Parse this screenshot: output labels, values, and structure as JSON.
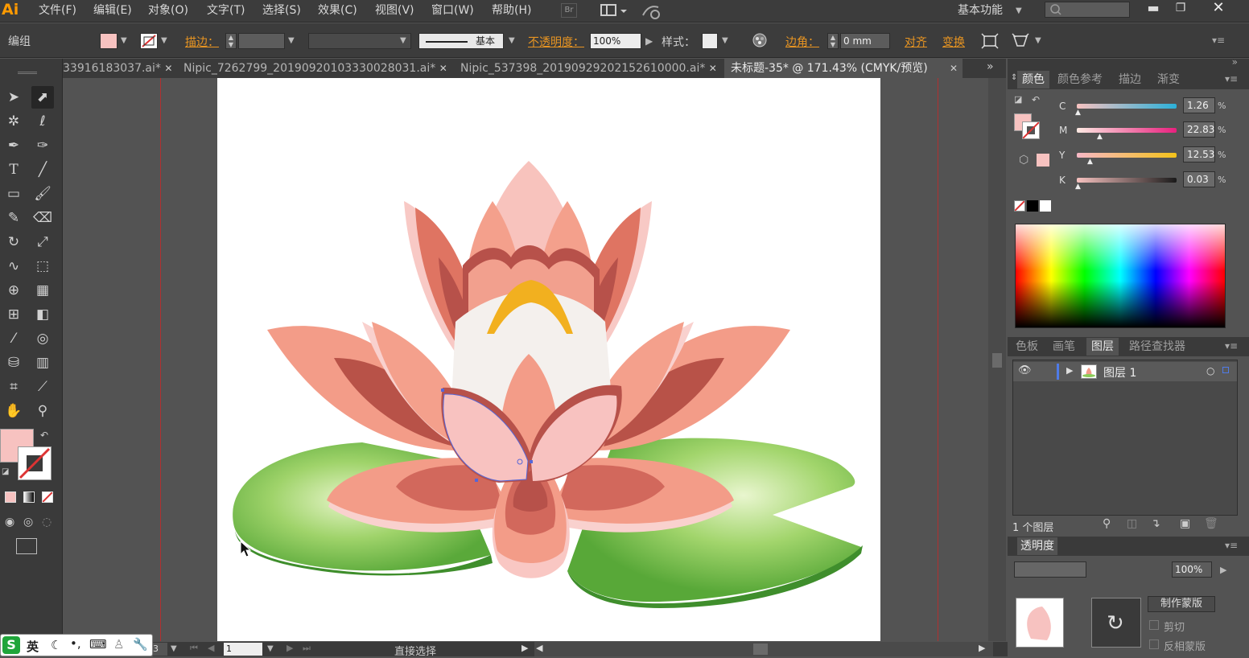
{
  "app": {
    "logo": "Ai"
  },
  "menu": {
    "items": [
      "文件(F)",
      "编辑(E)",
      "对象(O)",
      "文字(T)",
      "选择(S)",
      "效果(C)",
      "视图(V)",
      "窗口(W)",
      "帮助(H)"
    ],
    "br_badge": "Br",
    "workspace": "基本功能"
  },
  "control": {
    "selection_label": "编组",
    "stroke_label": "描边：",
    "stroke_profile": "基本",
    "opacity_label": "不透明度：",
    "opacity_value": "100%",
    "style_label": "样式：",
    "corner_label": "边角：",
    "corner_value": "0 mm",
    "align_label": "对齐",
    "transform_label": "变换"
  },
  "tabs": [
    {
      "label": "33916183037.ai*",
      "active": false
    },
    {
      "label": "Nipic_7262799_20190920103330028031.ai*",
      "active": false
    },
    {
      "label": "Nipic_537398_20190929202152610000.ai*",
      "active": false
    },
    {
      "label": "未标题-35* @ 171.43% (CMYK/预览)",
      "active": true
    }
  ],
  "color_panel": {
    "tabs": [
      "颜色",
      "颜色参考",
      "描边",
      "渐变"
    ],
    "channels": [
      {
        "label": "C",
        "value": "1.26"
      },
      {
        "label": "M",
        "value": "22.83"
      },
      {
        "label": "Y",
        "value": "12.53"
      },
      {
        "label": "K",
        "value": "0.03"
      }
    ],
    "percent": "%",
    "fill_color": "#f7c2c0"
  },
  "layers_panel": {
    "tabs": [
      "色板",
      "画笔",
      "图层",
      "路径查找器"
    ],
    "layer_name": "图层 1",
    "layer_count": "1 个图层"
  },
  "transparency_panel": {
    "title": "透明度",
    "opacity": "100%",
    "make_mask": "制作蒙版",
    "clip": "剪切",
    "invert_mask": "反相蒙版"
  },
  "status": {
    "zoom": "3",
    "page": "1",
    "tool_name": "直接选择"
  },
  "ime": {
    "lang": "英"
  },
  "colors": {
    "accent_orange": "#e89522",
    "panel_bg": "#535353",
    "dark_bg": "#3c3c3c"
  }
}
